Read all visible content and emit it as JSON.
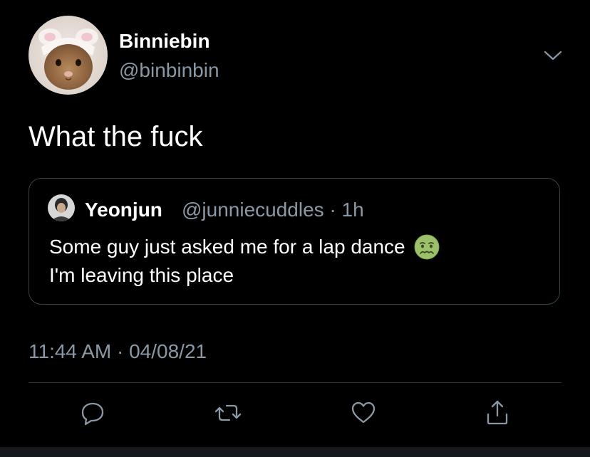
{
  "author": {
    "display_name": "Binniebin",
    "handle": "@binbinbin"
  },
  "tweet": {
    "text": "What the fuck"
  },
  "quoted_tweet": {
    "display_name": "Yeonjun",
    "meta": "@junniecuddles · 1h",
    "line1": "Some guy just asked me for a lap dance",
    "line2": "I'm leaving this place",
    "emoji": "nauseated-face"
  },
  "timestamp": "11:44 AM · 04/08/21",
  "actions": [
    "reply",
    "retweet",
    "like",
    "share"
  ],
  "colors": {
    "background": "#000000",
    "text": "#ffffff",
    "secondary": "#8b98a5",
    "border": "#38444d"
  }
}
